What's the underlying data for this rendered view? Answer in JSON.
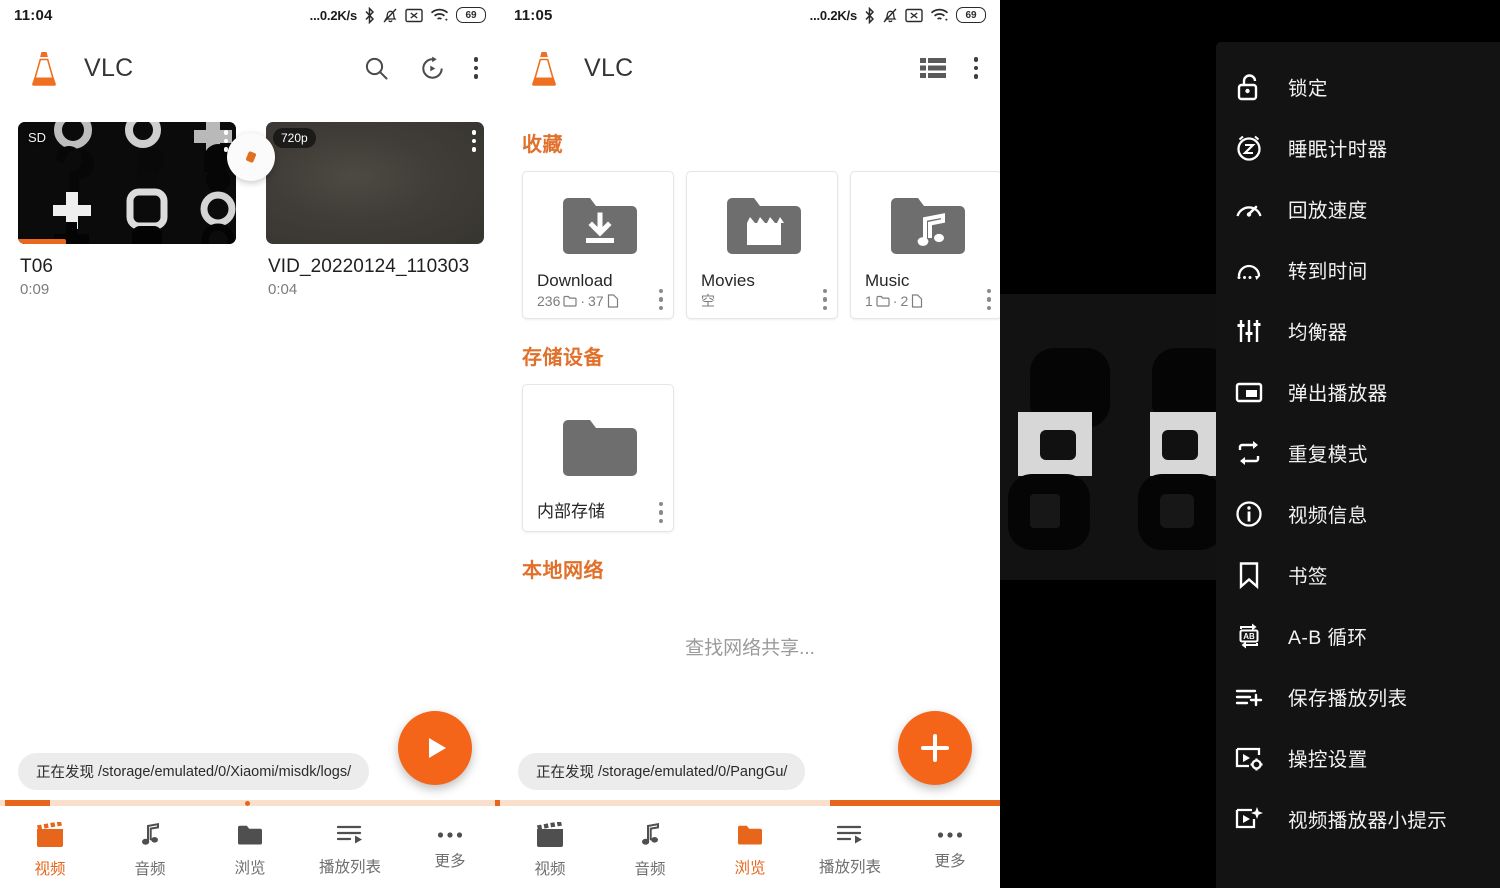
{
  "panels": {
    "video_list": {
      "status": {
        "time": "11:04",
        "speed": "...0.2K/s",
        "battery": "69",
        "icons": [
          "bluetooth-icon",
          "bell-muted-icon",
          "sim-x-icon",
          "wifi-icon",
          "battery-icon"
        ]
      },
      "appbar": {
        "title": "VLC",
        "logo": "vlc-cone-logo",
        "actions": [
          {
            "name": "search-icon",
            "label": "搜索"
          },
          {
            "name": "history-icon",
            "label": "最近播放"
          },
          {
            "name": "overflow-menu-icon",
            "label": "更多选项"
          }
        ]
      },
      "videos": [
        {
          "title": "T06",
          "duration": "0:09",
          "quality_badge": "SD",
          "watched_percent": 22
        },
        {
          "title": "VID_20220124_110303",
          "duration": "0:04",
          "quality_badge": "720p",
          "watched_percent": 0
        }
      ],
      "toast": {
        "prefix": "正在发现",
        "path": "/storage/emulated/0/Xiaomi/misdk/logs/"
      },
      "fab": {
        "name": "play-fab",
        "icon": "play-icon"
      },
      "progress": {
        "seg_left_pct": 1,
        "seg_width_pct": 9,
        "seg2_left_pct": 99,
        "seg2_width_pct": 1,
        "pip_pct": 49
      },
      "nav": {
        "active_index": 0,
        "items": [
          {
            "label": "视频",
            "icon": "clapperboard-icon"
          },
          {
            "label": "音频",
            "icon": "music-note-icon"
          },
          {
            "label": "浏览",
            "icon": "folder-icon"
          },
          {
            "label": "播放列表",
            "icon": "playlist-icon"
          },
          {
            "label": "更多",
            "icon": "more-dots-icon"
          }
        ]
      }
    },
    "browse": {
      "status": {
        "time": "11:05",
        "speed": "...0.2K/s",
        "battery": "69"
      },
      "appbar": {
        "title": "VLC",
        "logo": "vlc-cone-logo",
        "actions": [
          {
            "name": "list-view-icon",
            "label": "列表显示"
          },
          {
            "name": "overflow-menu-icon",
            "label": "更多选项"
          }
        ]
      },
      "sections": [
        {
          "title": "收藏",
          "cards": [
            {
              "name": "Download",
              "icon": "folder-download-icon",
              "folders": "236",
              "files": "37",
              "meta_empty": ""
            },
            {
              "name": "Movies",
              "icon": "folder-movie-icon",
              "folders": "",
              "files": "",
              "meta_empty": "空"
            },
            {
              "name": "Music",
              "icon": "folder-music-icon",
              "folders": "1",
              "files": "2",
              "meta_empty": ""
            }
          ]
        },
        {
          "title": "存储设备",
          "cards": [
            {
              "name": "内部存储",
              "icon": "folder-plain-icon",
              "folders": "",
              "files": "",
              "meta_empty": ""
            }
          ]
        },
        {
          "title": "本地网络",
          "empty_text": "查找网络共享..."
        }
      ],
      "toast": {
        "prefix": "正在发现",
        "path": "/storage/emulated/0/PangGu/"
      },
      "fab": {
        "name": "add-fab",
        "icon": "plus-icon"
      },
      "progress": {
        "seg_left_pct": 66,
        "seg_width_pct": 34
      },
      "nav": {
        "active_index": 2,
        "items": [
          {
            "label": "视频",
            "icon": "clapperboard-icon"
          },
          {
            "label": "音频",
            "icon": "music-note-icon"
          },
          {
            "label": "浏览",
            "icon": "folder-icon"
          },
          {
            "label": "播放列表",
            "icon": "playlist-icon"
          },
          {
            "label": "更多",
            "icon": "more-dots-icon"
          }
        ]
      }
    },
    "player": {
      "options_menu": [
        {
          "label": "锁定",
          "icon": "lock-icon"
        },
        {
          "label": "睡眠计时器",
          "icon": "sleep-timer-icon"
        },
        {
          "label": "回放速度",
          "icon": "speedometer-icon"
        },
        {
          "label": "转到时间",
          "icon": "jump-to-time-icon"
        },
        {
          "label": "均衡器",
          "icon": "equalizer-icon"
        },
        {
          "label": "弹出播放器",
          "icon": "popup-player-icon"
        },
        {
          "label": "重复模式",
          "icon": "repeat-icon"
        },
        {
          "label": "视频信息",
          "icon": "info-icon"
        },
        {
          "label": "书签",
          "icon": "bookmark-icon"
        },
        {
          "label": "A-B 循环",
          "icon": "ab-repeat-icon"
        },
        {
          "label": "保存播放列表",
          "icon": "playlist-add-icon"
        },
        {
          "label": "操控设置",
          "icon": "controls-settings-icon"
        },
        {
          "label": "视频播放器小提示",
          "icon": "video-tips-icon"
        }
      ]
    }
  },
  "colors": {
    "accent": "#e8651c",
    "accent_light": "#fadfcd",
    "heading": "#e0702a",
    "folder_grey": "#6e6e6e",
    "menu_bg": "#131313"
  }
}
